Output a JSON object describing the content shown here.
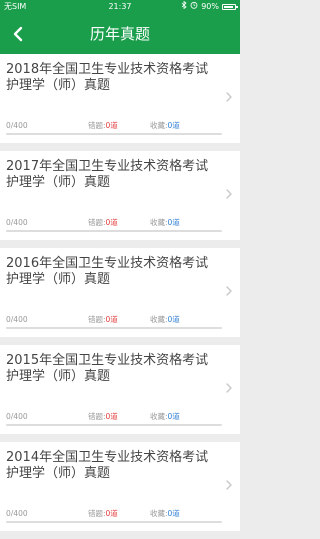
{
  "status_bar": {
    "carrier": "无SIM",
    "time": "21:37",
    "battery": "90%",
    "battery_level": 0.9
  },
  "header": {
    "title": "历年真题"
  },
  "labels": {
    "wrong": "错题:",
    "fav": "收藏:"
  },
  "items": [
    {
      "title": "2018年全国卫生专业技术资格考试 护理学（师）真题",
      "progress": "0/400",
      "wrong": "0道",
      "fav": "0道"
    },
    {
      "title": "2017年全国卫生专业技术资格考试 护理学（师）真题",
      "progress": "0/400",
      "wrong": "0道",
      "fav": "0道"
    },
    {
      "title": "2016年全国卫生专业技术资格考试 护理学（师）真题",
      "progress": "0/400",
      "wrong": "0道",
      "fav": "0道"
    },
    {
      "title": "2015年全国卫生专业技术资格考试 护理学（师）真题",
      "progress": "0/400",
      "wrong": "0道",
      "fav": "0道"
    },
    {
      "title": "2014年全国卫生专业技术资格考试 护理学（师）真题",
      "progress": "0/400",
      "wrong": "0道",
      "fav": "0道"
    }
  ]
}
